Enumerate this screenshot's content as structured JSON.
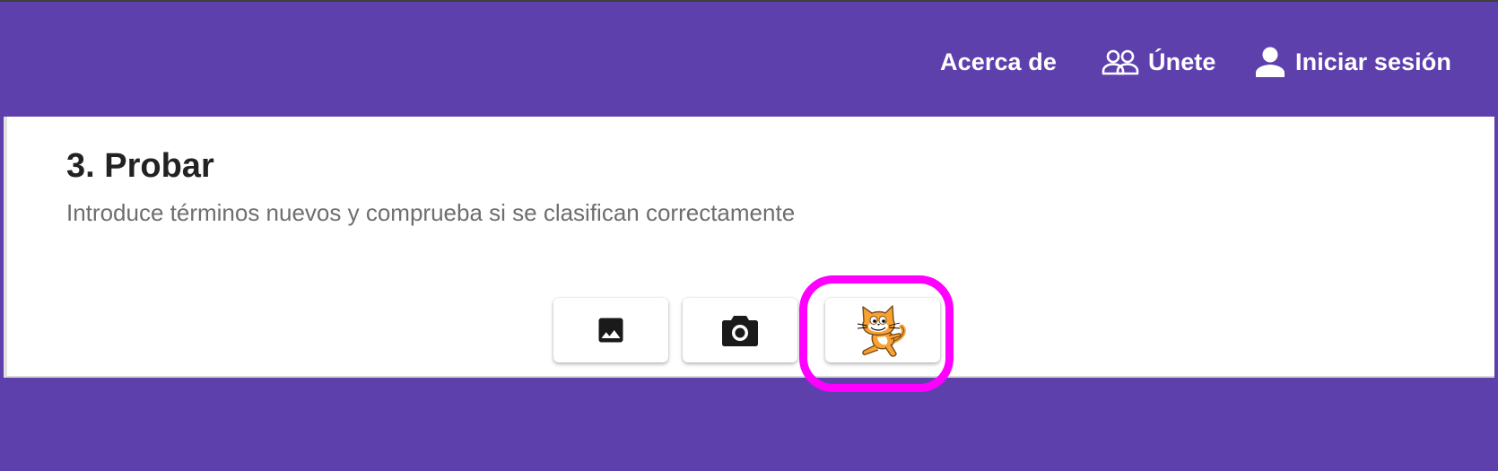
{
  "navbar": {
    "items": [
      {
        "label": "Acerca de",
        "icon": null
      },
      {
        "label": "Únete",
        "icon": "group-icon"
      },
      {
        "label": "Iniciar sesión",
        "icon": "person-icon"
      }
    ],
    "background_color": "#5e40ad"
  },
  "test_panel": {
    "title": "3. Probar",
    "subtitle": "Introduce términos nuevos y comprueba si se clasifican correctamente",
    "buttons": [
      {
        "icon": "image-icon"
      },
      {
        "icon": "camera-icon"
      },
      {
        "icon": "scratch-cat-icon"
      }
    ]
  },
  "highlight": {
    "target": "scratch-cat-icon",
    "color": "#ff00ff"
  }
}
